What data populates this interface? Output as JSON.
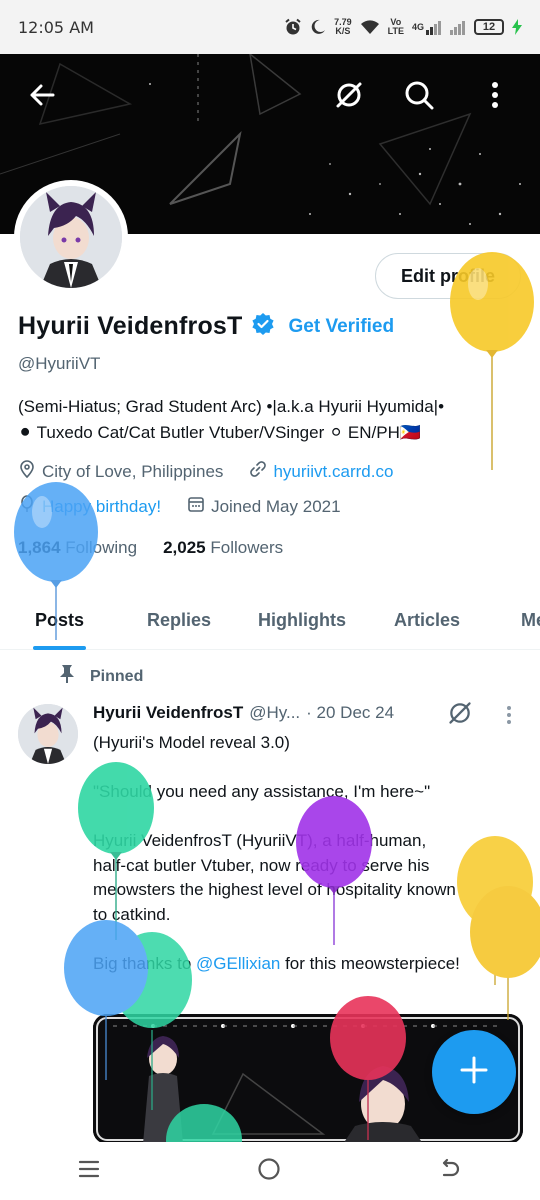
{
  "status_bar": {
    "time": "12:05 AM",
    "speed_value": "7.79",
    "speed_unit": "K/S",
    "volte_top": "Vo",
    "volte_bottom": "LTE",
    "network": "4G",
    "battery": "12"
  },
  "profile": {
    "edit_label": "Edit profile",
    "name": "Hyurii VeidenfrosT",
    "get_verified": "Get Verified",
    "handle": "@HyuriiVT",
    "bio_line1": "(Semi-Hiatus; Grad Student Arc) •|a.k.a Hyurii Hyumida|•",
    "bio_line2": "⚫ Tuxedo Cat/Cat Butler Vtuber/VSinger ⚪ EN/PH🇵🇭",
    "location": "City of Love, Philippines",
    "website": "hyuriivt.carrd.co",
    "birthday": "Happy birthday!",
    "joined": "Joined May 2021",
    "following_count": "1,864",
    "following_label": "Following",
    "followers_count": "2,025",
    "followers_label": "Followers"
  },
  "tabs": [
    {
      "label": "Posts",
      "active": true
    },
    {
      "label": "Replies"
    },
    {
      "label": "Highlights"
    },
    {
      "label": "Articles"
    },
    {
      "label": "Media"
    }
  ],
  "pinned_post": {
    "pinned_label": "Pinned",
    "author_name": "Hyurii VeidenfrosT",
    "author_handle": "@Hy...",
    "date": "· 20 Dec 24",
    "lines": [
      "(Hyurii's Model reveal 3.0)",
      "",
      "\"Should you need any assistance, I'm here~\"",
      "",
      "Hyurii VeidenfrosT (HyuriiVT), a half-human,",
      "half-cat butler Vtuber, now ready to serve his",
      "meowsters the highest level of hospitality known",
      "to catkind.",
      "",
      "Big thanks to "
    ],
    "mention": "@GEllixian",
    "mention_suffix": " for this meowsterpiece!"
  },
  "icons": {
    "back": "back-arrow-icon",
    "grok": "grok-icon",
    "search": "search-icon",
    "more": "more-vertical-icon",
    "location": "location-pin-icon",
    "link": "link-icon",
    "balloon": "balloon-icon",
    "calendar": "calendar-icon",
    "verified": "verified-badge-icon",
    "pin": "pin-icon",
    "compose": "plus-icon"
  },
  "colors": {
    "accent": "#1d9bf0",
    "text": "#0f1419",
    "secondary": "#536471"
  }
}
